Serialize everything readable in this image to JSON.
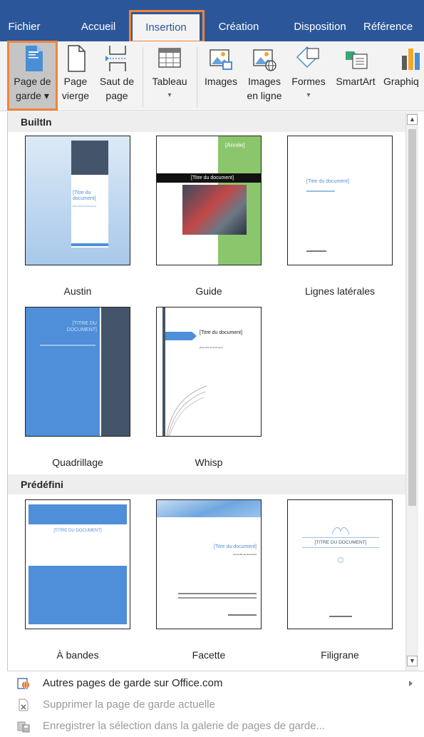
{
  "tabs": [
    {
      "label": "Fichier"
    },
    {
      "label": "Accueil"
    },
    {
      "label": "Insertion"
    },
    {
      "label": "Création"
    },
    {
      "label": "Disposition"
    },
    {
      "label": "Référence"
    }
  ],
  "ribbon": {
    "cover_page": {
      "line1": "Page de",
      "line2": "garde ▾"
    },
    "blank_page": {
      "line1": "Page",
      "line2": "vierge"
    },
    "page_break": {
      "line1": "Saut de",
      "line2": "page"
    },
    "table": {
      "line1": "Tableau",
      "line2": "▾"
    },
    "images": {
      "line1": "Images"
    },
    "online_images": {
      "line1": "Images",
      "line2": "en ligne"
    },
    "shapes": {
      "line1": "Formes",
      "line2": "▾"
    },
    "smartart": {
      "line1": "SmartArt"
    },
    "chart": {
      "line1": "Graphiq"
    }
  },
  "gallery": {
    "builtin_header": "BuiltIn",
    "predefined_header": "Prédéfini",
    "templates": [
      {
        "name": "Austin",
        "title": "[Titre du document]",
        "subtitle": "[Sous-titre du document]"
      },
      {
        "name": "Guide",
        "year": "[Année]",
        "title": "[Titre du document]"
      },
      {
        "name": "Lignes latérales",
        "title": "[Titre du document]"
      },
      {
        "name": "Quadrillage",
        "title": "[TITRE DU DOCUMENT]"
      },
      {
        "name": "Whisp",
        "title": "[Titre du document]",
        "subtitle": "[Sous-titre du document]"
      },
      {
        "name": "À bandes",
        "title": "[TITRE DU DOCUMENT]"
      },
      {
        "name": "Facette",
        "title": "[Titre du document]",
        "subtitle": "[Sous-titre du document]"
      },
      {
        "name": "Filigrane",
        "title": "[TITRE DU DOCUMENT]"
      }
    ]
  },
  "menu": [
    {
      "label": "Autres pages de garde sur Office.com",
      "icon": "office-globe-icon",
      "disabled": false,
      "submenu": true
    },
    {
      "label": "Supprimer la page de garde actuelle",
      "icon": "delete-page-icon",
      "disabled": true,
      "submenu": false
    },
    {
      "label": "Enregistrer la sélection dans la galerie de pages de garde...",
      "icon": "save-gallery-icon",
      "disabled": true,
      "submenu": false
    }
  ],
  "colors": {
    "title_bar": "#2b579a",
    "highlight": "#f2843a",
    "ribbon": "#f3f3f3",
    "accent_blue": "#4f8ed8",
    "guide_green": "#8bc66d"
  }
}
